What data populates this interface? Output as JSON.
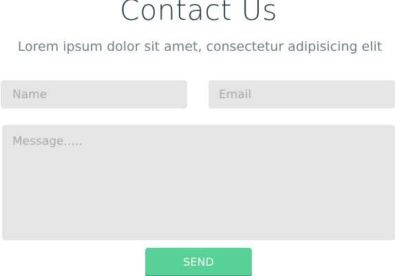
{
  "header": {
    "title": "Contact Us",
    "subtitle": "Lorem ipsum dolor sit amet, consectetur adipisicing elit"
  },
  "form": {
    "name": {
      "value": "",
      "placeholder": "Name"
    },
    "email": {
      "value": "",
      "placeholder": "Email"
    },
    "message": {
      "value": "",
      "placeholder": "Message....."
    },
    "send_label": "SEND"
  },
  "colors": {
    "title": "#1f3b3f",
    "subtitle": "#6f7f86",
    "field_background": "#e5e5e5",
    "placeholder": "#a9a9a9",
    "send_background": "#57d195",
    "send_shadow": "#2f9c6a",
    "send_text": "#ffffff"
  }
}
